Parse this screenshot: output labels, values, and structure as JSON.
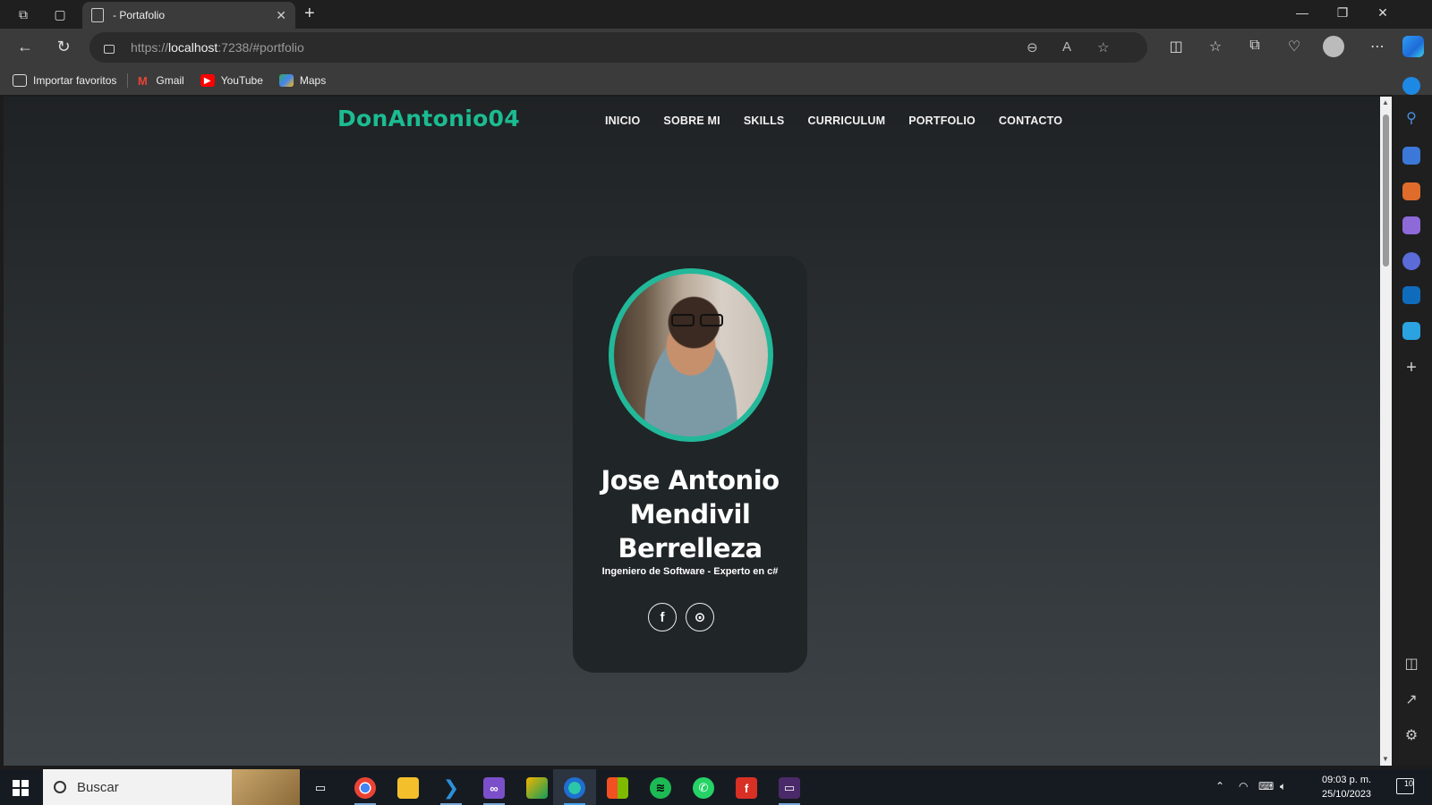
{
  "browser": {
    "tab_title": "- Portafolio",
    "url_host": "localhost",
    "url_prefix": "https://",
    "url_rest": ":7238/#portfolio",
    "favorites": [
      {
        "label": "Importar favoritos",
        "icon": "import-favorites-icon"
      },
      {
        "label": "Gmail",
        "icon": "gmail-icon"
      },
      {
        "label": "YouTube",
        "icon": "youtube-icon"
      },
      {
        "label": "Maps",
        "icon": "maps-icon"
      }
    ]
  },
  "site": {
    "brand": "DonAntonio04",
    "nav": [
      "INICIO",
      "SOBRE MI",
      "SKILLS",
      "CURRICULUM",
      "PORTFOLIO",
      "CONTACTO"
    ],
    "profile": {
      "name_line1": "Jose Antonio",
      "name_line2": "Mendivil",
      "name_line3": "Berrelleza",
      "subtitle": "Ingeniero de Software - Experto en c#",
      "socials": [
        "facebook-icon",
        "github-icon"
      ]
    }
  },
  "taskbar": {
    "search_placeholder": "Buscar",
    "time": "09:03 p. m.",
    "date": "25/10/2023",
    "notifications": "10"
  },
  "colors": {
    "accent": "#1bbc91",
    "ring": "#22b89a",
    "card_bg": "#202527"
  }
}
